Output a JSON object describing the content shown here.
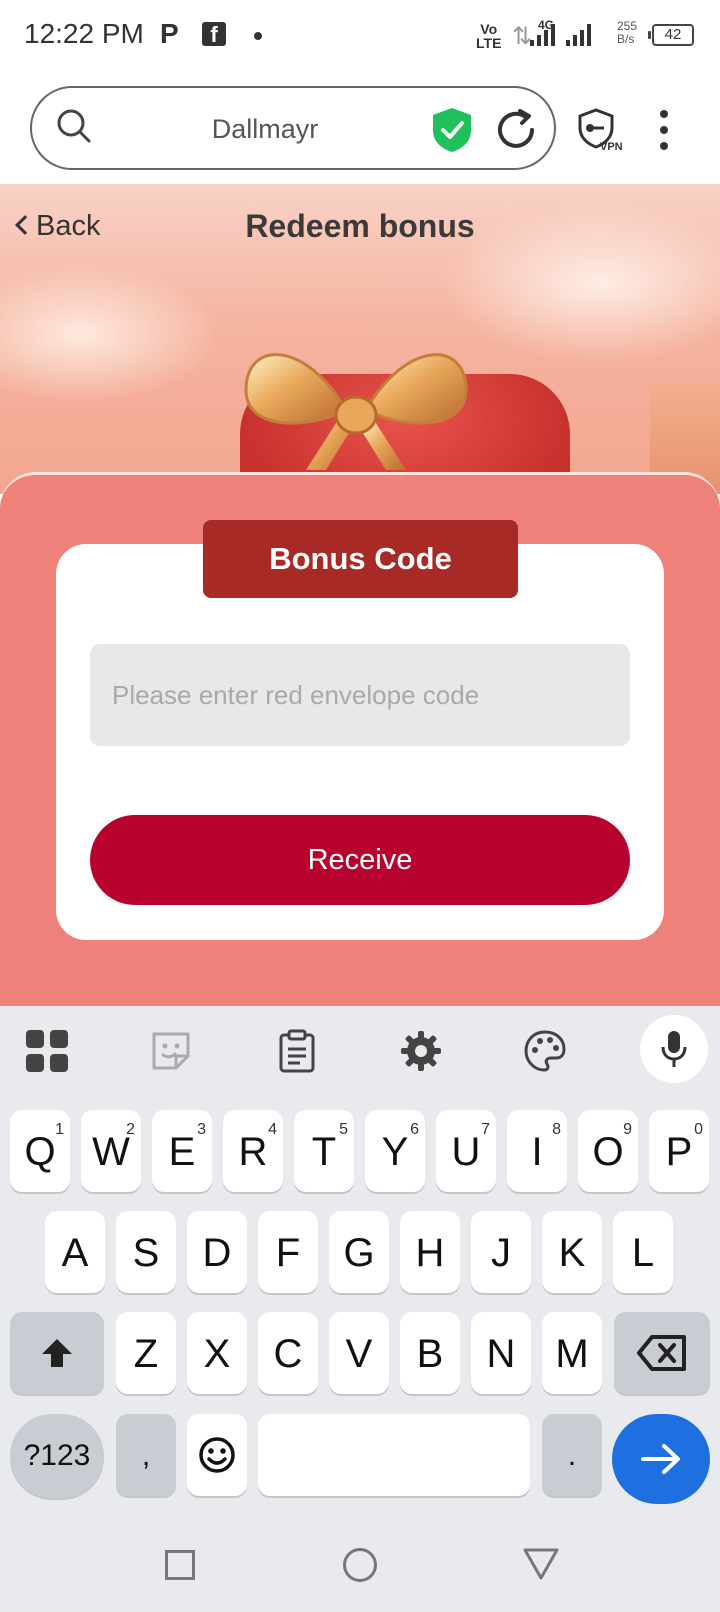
{
  "status_bar": {
    "time": "12:22 PM",
    "icon_p": "P",
    "icon_f": "f",
    "network_label": "Vo LTE",
    "network_top": "Vo",
    "network_bottom": "LTE",
    "network_type": "4G",
    "speed_value": "255",
    "speed_unit": "B/s",
    "battery": "42"
  },
  "browser": {
    "url": "Dallmayr",
    "vpn_label": "VPN",
    "icons": [
      "search-icon",
      "shield-check-icon",
      "reload-icon",
      "vpn-icon",
      "more-vert-icon"
    ],
    "shield_color": "#1ec15a"
  },
  "page": {
    "back_label": "Back",
    "title": "Redeem bonus",
    "card_tab": "Bonus Code",
    "input_placeholder": "Please enter red envelope code",
    "input_value": "",
    "receive_label": "Receive",
    "colors": {
      "panel": "#ee8179",
      "tab": "#a82a26",
      "button": "#b8022e"
    }
  },
  "keyboard": {
    "toolbar": [
      "apps-icon",
      "sticker-icon",
      "clipboard-icon",
      "settings-icon",
      "palette-icon",
      "mic-icon"
    ],
    "row1": [
      "Q",
      "W",
      "E",
      "R",
      "T",
      "Y",
      "U",
      "I",
      "O",
      "P"
    ],
    "row1_hints": [
      "1",
      "2",
      "3",
      "4",
      "5",
      "6",
      "7",
      "8",
      "9",
      "0"
    ],
    "row2": [
      "A",
      "S",
      "D",
      "F",
      "G",
      "H",
      "J",
      "K",
      "L"
    ],
    "row3": [
      "Z",
      "X",
      "C",
      "V",
      "B",
      "N",
      "M"
    ],
    "symbols_label": "?123",
    "comma": ",",
    "period": ".",
    "go_color": "#1e6fe0"
  },
  "navigation": [
    "recents-icon",
    "home-icon",
    "back-icon"
  ]
}
